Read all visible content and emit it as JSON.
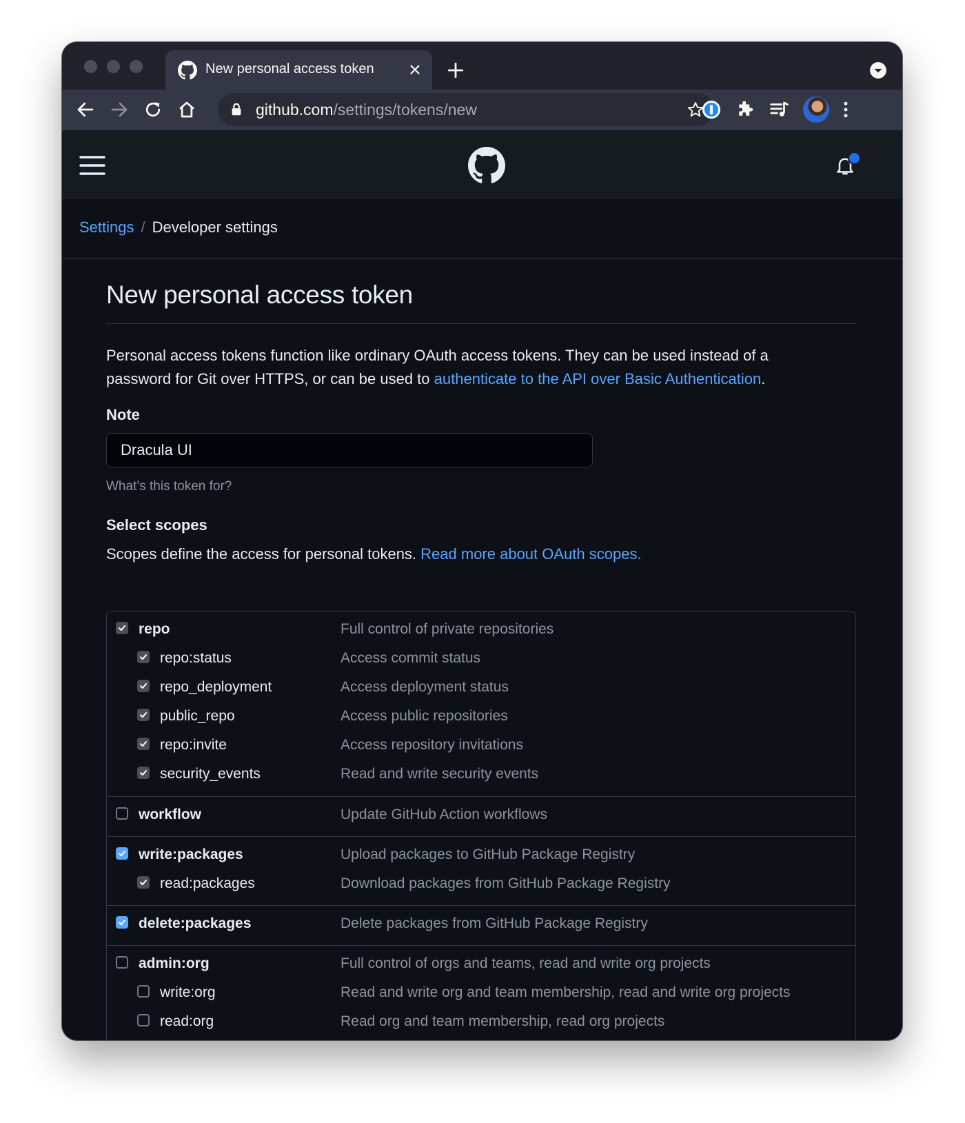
{
  "browser": {
    "tab": {
      "title": "New personal access token"
    },
    "url": {
      "host": "github.com",
      "path": "/settings/tokens/new"
    }
  },
  "breadcrumb": {
    "parent": "Settings",
    "separator": "/",
    "current": "Developer settings"
  },
  "page": {
    "title": "New personal access token",
    "intro_text": "Personal access tokens function like ordinary OAuth access tokens. They can be used instead of a password for Git over HTTPS, or can be used to ",
    "intro_link": "authenticate to the API over Basic Authentication",
    "intro_end": ".",
    "note_label": "Note",
    "note_value": "Dracula UI",
    "note_help": "What’s this token for?",
    "scopes_label": "Select scopes",
    "scopes_desc": "Scopes define the access for personal tokens. ",
    "scopes_link": "Read more about OAuth scopes."
  },
  "scopes": [
    {
      "name": "repo",
      "desc": "Full control of private repositories",
      "checked": true,
      "style": "dim",
      "children": [
        {
          "name": "repo:status",
          "desc": "Access commit status",
          "checked": true,
          "style": "dim"
        },
        {
          "name": "repo_deployment",
          "desc": "Access deployment status",
          "checked": true,
          "style": "dim"
        },
        {
          "name": "public_repo",
          "desc": "Access public repositories",
          "checked": true,
          "style": "dim"
        },
        {
          "name": "repo:invite",
          "desc": "Access repository invitations",
          "checked": true,
          "style": "dim"
        },
        {
          "name": "security_events",
          "desc": "Read and write security events",
          "checked": true,
          "style": "dim"
        }
      ]
    },
    {
      "name": "workflow",
      "desc": "Update GitHub Action workflows",
      "checked": false,
      "children": []
    },
    {
      "name": "write:packages",
      "desc": "Upload packages to GitHub Package Registry",
      "checked": true,
      "style": "blue",
      "children": [
        {
          "name": "read:packages",
          "desc": "Download packages from GitHub Package Registry",
          "checked": true,
          "style": "dim"
        }
      ]
    },
    {
      "name": "delete:packages",
      "desc": "Delete packages from GitHub Package Registry",
      "checked": true,
      "style": "blue",
      "children": []
    },
    {
      "name": "admin:org",
      "desc": "Full control of orgs and teams, read and write org projects",
      "checked": false,
      "children": [
        {
          "name": "write:org",
          "desc": "Read and write org and team membership, read and write org projects",
          "checked": false
        },
        {
          "name": "read:org",
          "desc": "Read org and team membership, read org projects",
          "checked": false
        }
      ]
    }
  ],
  "colors": {
    "link": "#58a6ff",
    "checkbox_blue": "#58a6ff",
    "checkbox_dim": "#4b4f56",
    "notification_dot": "#1f6feb"
  }
}
